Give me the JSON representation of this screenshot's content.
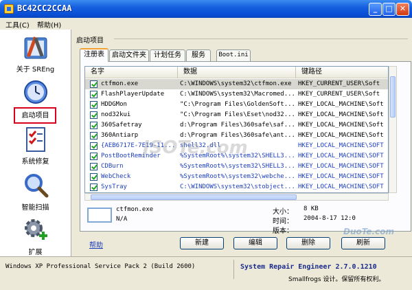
{
  "window": {
    "title": "BC42CC2CCAA"
  },
  "menu": {
    "tools": "工具(C)",
    "help": "帮助(H)"
  },
  "sidebar": {
    "items": [
      {
        "label": "关于 SREng",
        "icon": "tools-icon"
      },
      {
        "label": "启动项目",
        "icon": "clock-icon"
      },
      {
        "label": "系统修复",
        "icon": "checklist-icon"
      },
      {
        "label": "智能扫描",
        "icon": "magnifier-icon"
      },
      {
        "label": "扩展",
        "icon": "gear-plus-icon"
      }
    ]
  },
  "main": {
    "group_title": "启动项目",
    "tabs": [
      "注册表",
      "启动文件夹",
      "计划任务",
      "服务",
      "Boot.ini"
    ],
    "columns": [
      "名字",
      "数据",
      "键路径"
    ],
    "rows": [
      {
        "name": "ctfmon.exe",
        "data": "C:\\WINDOWS\\system32\\ctfmon.exe",
        "key": "HKEY_CURRENT_USER\\Soft"
      },
      {
        "name": "FlashPlayerUpdate",
        "data": "C:\\WINDOWS\\system32\\Macromed...",
        "key": "HKEY_CURRENT_USER\\Soft"
      },
      {
        "name": "HDDGMon",
        "data": "\"C:\\Program Files\\GoldenSoft...",
        "key": "HKEY_LOCAL_MACHINE\\Soft"
      },
      {
        "name": "nod32kui",
        "data": "\"C:\\Program Files\\Eset\\nod32...",
        "key": "HKEY_LOCAL_MACHINE\\Soft"
      },
      {
        "name": "360Safetray",
        "data": "d:\\Program Files\\360safe\\saf...",
        "key": "HKEY_LOCAL_MACHINE\\Soft"
      },
      {
        "name": "360Antiarp",
        "data": "d:\\Program Files\\360safe\\ant...",
        "key": "HKEY_LOCAL_MACHINE\\Soft"
      },
      {
        "name": "{AEB6717E-7E19-11...",
        "data": "shell32.dll",
        "key": "HKEY_LOCAL_MACHINE\\SOFT"
      },
      {
        "name": "PostBootReminder",
        "data": "%SystemRoot%\\system32\\SHELL3...",
        "key": "HKEY_LOCAL_MACHINE\\SOFT"
      },
      {
        "name": "CDBurn",
        "data": "%SystemRoot%\\system32\\SHELL3...",
        "key": "HKEY_LOCAL_MACHINE\\SOFT"
      },
      {
        "name": "WebCheck",
        "data": "%SystemRoot%\\system32\\webche...",
        "key": "HKEY_LOCAL_MACHINE\\SOFT"
      },
      {
        "name": "SysTray",
        "data": "C:\\WINDOWS\\system32\\stobject...",
        "key": "HKEY_LOCAL_MACHINE\\SOFT"
      }
    ],
    "detail": {
      "name": "ctfmon.exe",
      "data": "N/A",
      "size_label": "大小：",
      "size_value": "8 KB",
      "time_label": "时间：",
      "time_value": "2004-8-17 12:0",
      "version_label": "版本："
    },
    "help_link": "帮助",
    "buttons": {
      "new": "新建",
      "edit": "编辑",
      "delete": "删除",
      "refresh": "刷新"
    }
  },
  "status": {
    "os": "Windows XP Professional Service Pack 2 (Build 2600)",
    "product": "System Repair Engineer 2.7.0.1210",
    "copyright": "Smallfrogs 设计。保留所有权利。"
  },
  "watermark": {
    "center": "JSOTe.com",
    "corner": "DuoTe.com"
  },
  "colors": {
    "titlebar": "#0a4fd6",
    "highlight": "#d8001c",
    "link": "#1a3dbf",
    "check": "#21a121"
  }
}
